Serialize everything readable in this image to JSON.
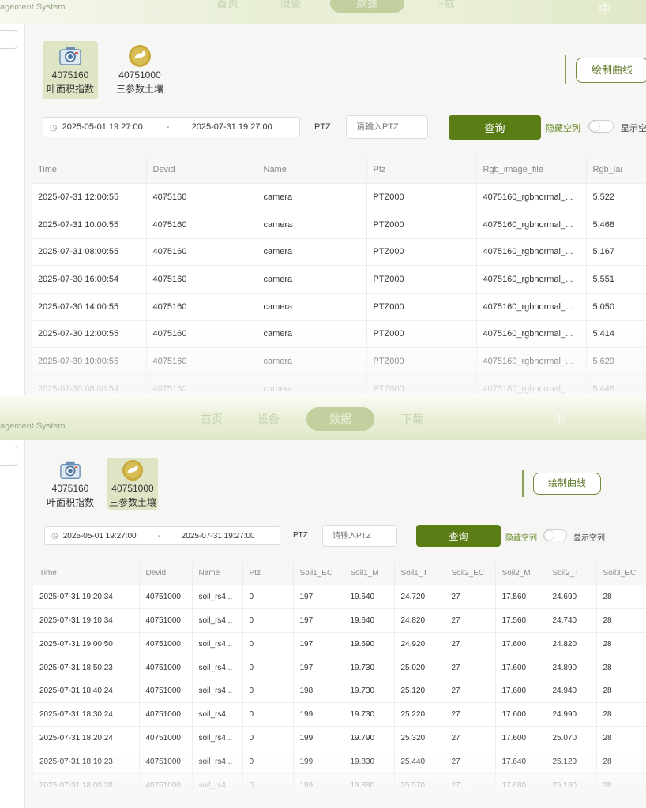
{
  "top": {
    "header": {
      "brand": "agement System",
      "nav": [
        "首页",
        "设备",
        "数据",
        "下载"
      ],
      "lang_icon": "中"
    },
    "devices": [
      {
        "id": "4075160",
        "name": "叶面积指数",
        "icon": "camera-icon",
        "selected": true
      },
      {
        "id": "40751000",
        "name": "三参数土壤",
        "icon": "soil-sensor-icon",
        "selected": false
      }
    ],
    "curve_button": "绘制曲线",
    "filters": {
      "start": "2025-05-01 19:27:00",
      "separator": "-",
      "end": "2025-07-31 19:27:00",
      "ptz_label": "PTZ",
      "ptz_placeholder": "请输入PTZ",
      "query": "查询",
      "hide_empty": "隐藏空列",
      "show_empty": "显示空列"
    },
    "table": {
      "columns": [
        "Time",
        "Devid",
        "Name",
        "Ptz",
        "Rgb_image_file",
        "Rgb_lai"
      ],
      "rows": [
        [
          "2025-07-31 12:00:55",
          "4075160",
          "camera",
          "PTZ000",
          "4075160_rgbnormal_...",
          "5.522"
        ],
        [
          "2025-07-31 10:00:55",
          "4075160",
          "camera",
          "PTZ000",
          "4075160_rgbnormal_...",
          "5.468"
        ],
        [
          "2025-07-31 08:00:55",
          "4075160",
          "camera",
          "PTZ000",
          "4075160_rgbnormal_...",
          "5.167"
        ],
        [
          "2025-07-30 16:00:54",
          "4075160",
          "camera",
          "PTZ000",
          "4075160_rgbnormal_...",
          "5.551"
        ],
        [
          "2025-07-30 14:00:55",
          "4075160",
          "camera",
          "PTZ000",
          "4075160_rgbnormal_...",
          "5.050"
        ],
        [
          "2025-07-30 12:00:55",
          "4075160",
          "camera",
          "PTZ000",
          "4075160_rgbnormal_...",
          "5.414"
        ],
        [
          "2025-07-30 10:00:55",
          "4075160",
          "camera",
          "PTZ000",
          "4075160_rgbnormal_...",
          "5.629"
        ],
        [
          "2025-07-30 08:00:54",
          "4075160",
          "camera",
          "PTZ000",
          "4075160_rgbnormal_...",
          "5.448"
        ]
      ]
    }
  },
  "bottom": {
    "header": {
      "brand": "agement System",
      "nav": [
        "首页",
        "设备",
        "数据",
        "下载"
      ],
      "lang_icon": "中"
    },
    "devices": [
      {
        "id": "4075160",
        "name": "叶面积指数",
        "icon": "camera-icon",
        "selected": false
      },
      {
        "id": "40751000",
        "name": "三参数土壤",
        "icon": "soil-sensor-icon",
        "selected": true
      }
    ],
    "curve_button": "绘制曲线",
    "filters": {
      "start": "2025-05-01 19:27:00",
      "separator": "-",
      "end": "2025-07-31 19:27:00",
      "ptz_label": "PTZ",
      "ptz_placeholder": "请输入PTZ",
      "query": "查询",
      "hide_empty": "隐藏空列",
      "show_empty": "显示空列"
    },
    "table": {
      "columns": [
        "Time",
        "Devid",
        "Name",
        "Ptz",
        "Soil1_EC",
        "Soil1_M",
        "Soil1_T",
        "Soil2_EC",
        "Soil2_M",
        "Soil2_T",
        "Soil3_EC"
      ],
      "rows": [
        [
          "2025-07-31 19:20:34",
          "40751000",
          "soil_rs4...",
          "0",
          "197",
          "19.640",
          "24.720",
          "27",
          "17.560",
          "24.690",
          "28"
        ],
        [
          "2025-07-31 19:10:34",
          "40751000",
          "soil_rs4...",
          "0",
          "197",
          "19.640",
          "24.820",
          "27",
          "17.560",
          "24.740",
          "28"
        ],
        [
          "2025-07-31 19:00:50",
          "40751000",
          "soil_rs4...",
          "0",
          "197",
          "19.690",
          "24.920",
          "27",
          "17.600",
          "24.820",
          "28"
        ],
        [
          "2025-07-31 18:50:23",
          "40751000",
          "soil_rs4...",
          "0",
          "197",
          "19.730",
          "25.020",
          "27",
          "17.600",
          "24.890",
          "28"
        ],
        [
          "2025-07-31 18:40:24",
          "40751000",
          "soil_rs4...",
          "0",
          "198",
          "19.730",
          "25.120",
          "27",
          "17.600",
          "24.940",
          "28"
        ],
        [
          "2025-07-31 18:30:24",
          "40751000",
          "soil_rs4...",
          "0",
          "199",
          "19.730",
          "25.220",
          "27",
          "17.600",
          "24.990",
          "28"
        ],
        [
          "2025-07-31 18:20:24",
          "40751000",
          "soil_rs4...",
          "0",
          "199",
          "19.790",
          "25.320",
          "27",
          "17.600",
          "25.070",
          "28"
        ],
        [
          "2025-07-31 18:10:23",
          "40751000",
          "soil_rs4...",
          "0",
          "199",
          "19.830",
          "25.440",
          "27",
          "17.640",
          "25.120",
          "28"
        ],
        [
          "2025-07-31 18:00:38",
          "40751000",
          "soil_rs4...",
          "0",
          "199",
          "19.880",
          "25.570",
          "27",
          "17.680",
          "25.190",
          "28"
        ]
      ]
    }
  },
  "colors": {
    "accent": "#5a7d15",
    "selected_card": "#dde5c4",
    "hide_label": "#6a8a2a"
  }
}
